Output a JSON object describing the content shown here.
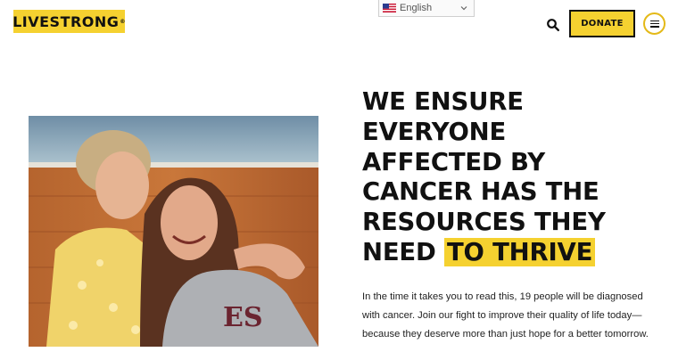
{
  "brand": {
    "logo_text": "LIVESTRONG",
    "logo_mark": "®",
    "accent": "#f5d130"
  },
  "header": {
    "language": "English",
    "language_flag": "us-flag-icon",
    "search_icon": "search-icon",
    "donate_label": "DONATE",
    "menu_icon": "hamburger-menu-icon"
  },
  "hero": {
    "headline_lines": [
      "WE ENSURE",
      "EVERYONE",
      "AFFECTED BY",
      "CANCER HAS THE",
      "RESOURCES THEY"
    ],
    "headline_last_prefix": "NEED ",
    "headline_highlight": "TO THRIVE",
    "body": "In the time it takes you to read this, 19 people will be diagnosed with cancer. Join our fight to improve their quality of life today—because they deserve more than just hope for a better tomorrow.",
    "image_alt": "Two women embracing and laughing"
  }
}
